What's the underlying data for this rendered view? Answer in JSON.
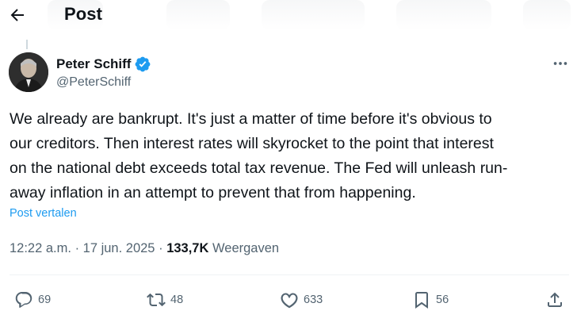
{
  "header": {
    "title": "Post"
  },
  "author": {
    "name": "Peter Schiff",
    "handle": "@PeterSchiff"
  },
  "post": {
    "text_lines": [
      "We already are bankrupt. It's just a matter of time before it's obvious to",
      "our creditors.  Then interest rates will skyrocket to the point that interest",
      "on the national debt exceeds total tax revenue. The Fed will unleash run-",
      "away inflation in an attempt to prevent that from happening."
    ],
    "translate_label": "Post vertalen",
    "time": "12:22 a.m.",
    "separator": "·",
    "date": "17 jun. 2025",
    "views_count": "133,7K",
    "views_label": "Weergaven"
  },
  "actions": {
    "replies": "69",
    "reposts": "48",
    "likes": "633",
    "bookmarks": "56"
  },
  "colors": {
    "text": "#0f1419",
    "secondary": "#536471",
    "link": "#1d9bf0",
    "verified": "#1d9bf0"
  },
  "icons": [
    "back-arrow-icon",
    "verified-badge-icon",
    "more-icon",
    "reply-icon",
    "repost-icon",
    "like-icon",
    "bookmark-icon",
    "share-icon"
  ]
}
